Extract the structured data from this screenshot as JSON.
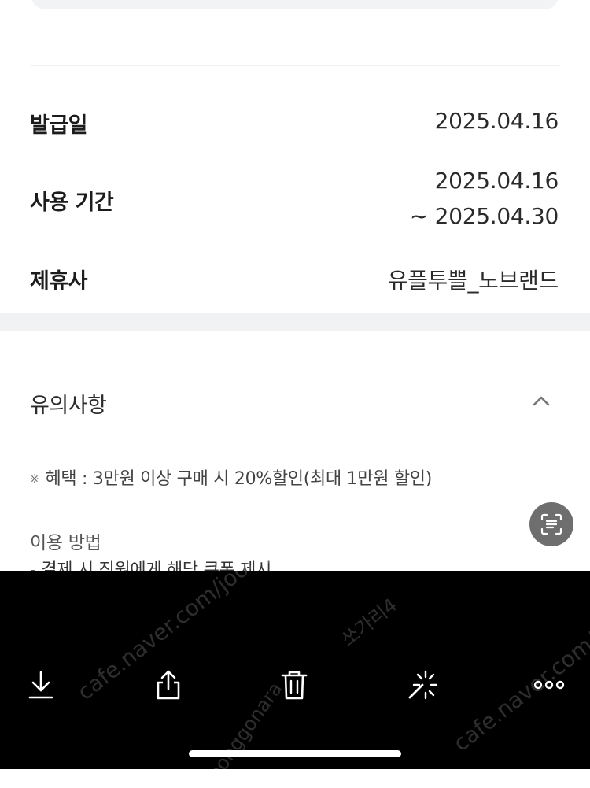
{
  "details": {
    "issue_date": {
      "label": "발급일",
      "value": "2025.04.16"
    },
    "usage_period": {
      "label": "사용 기간",
      "value_line1": "2025.04.16",
      "value_line2": "~ 2025.04.30"
    },
    "partner": {
      "label": "제휴사",
      "value": "유플투쁠_노브랜드"
    }
  },
  "notice": {
    "title": "유의사항",
    "benefit_mark": "※",
    "benefit_text": "혜택 : 3만원 이상 구매 시 20%할인(최대 1만원 할인)",
    "howto_title": "이용 방법",
    "howto_line": "- 결제 시 직원에게 해당 쿠폰 제시"
  },
  "toolbar": {
    "icons": [
      "download-icon",
      "share-icon",
      "trash-icon",
      "magic-edit-icon",
      "more-icon"
    ]
  },
  "watermarks": [
    "cafe.naver.com/joonggonara",
    "쏘가리4",
    "cafe.naver.com/joo",
    "joonggonara"
  ],
  "colors": {
    "toolbar_bg": "#000000",
    "section_gap": "#f1f2f4",
    "scan_button": "#6e6e6e"
  }
}
